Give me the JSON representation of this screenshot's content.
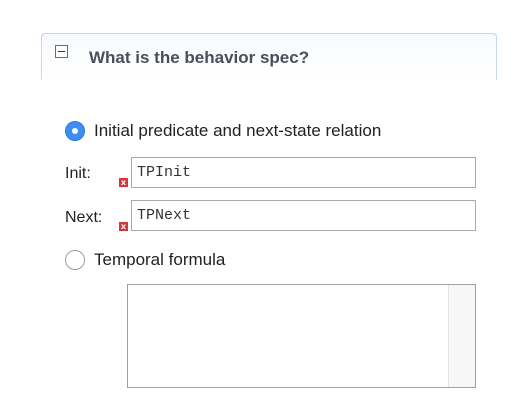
{
  "section": {
    "title": "What is the behavior spec?",
    "toggle_symbol": "−"
  },
  "init_next_option": {
    "label": "Initial predicate and next-state relation",
    "selected": true
  },
  "init_field": {
    "label": "Init:",
    "value": "TPInit",
    "error_marker": "x"
  },
  "next_field": {
    "label": "Next:",
    "value": "TPNext",
    "error_marker": "x"
  },
  "temporal_option": {
    "label": "Temporal formula",
    "selected": false
  },
  "temporal_formula": {
    "value": ""
  },
  "colors": {
    "radio_selected": "#3d8ef0",
    "error_marker": "#cf3a3a",
    "header_border": "#c7d6e8",
    "title_text": "#4d4d5a"
  }
}
